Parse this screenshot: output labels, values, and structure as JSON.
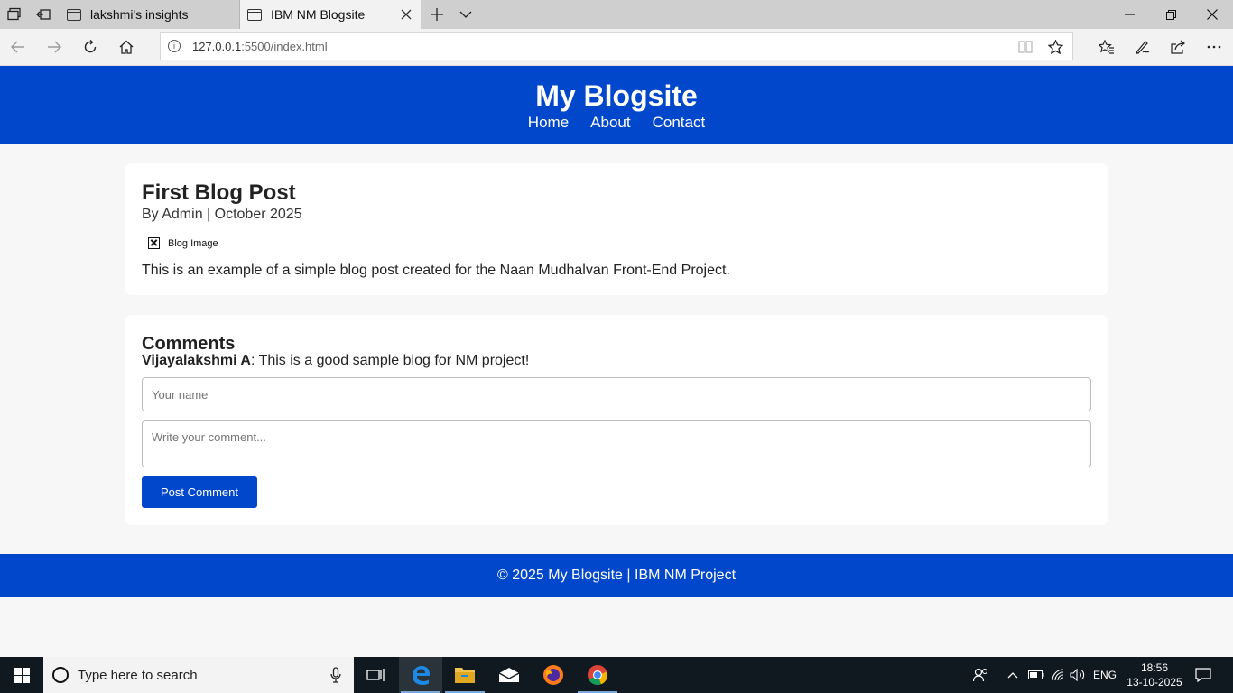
{
  "browser": {
    "tabs": [
      {
        "label": "lakshmi's insights"
      },
      {
        "label": "IBM NM Blogsite"
      }
    ],
    "url": {
      "host": "127.0.0.1",
      "path": ":5500/index.html"
    }
  },
  "site": {
    "title": "My Blogsite",
    "nav": [
      "Home",
      "About",
      "Contact"
    ],
    "post": {
      "title": "First Blog Post",
      "meta": "By Admin | October 2025",
      "image_alt": "Blog Image",
      "body": "This is an example of a simple blog post created for the Naan Mudhalvan Front-End Project."
    },
    "comments": {
      "title": "Comments",
      "items": [
        {
          "author": "Vijayalakshmi A",
          "text": ": This is a good sample blog for NM project!"
        }
      ],
      "name_placeholder": "Your name",
      "comment_placeholder": "Write your comment...",
      "submit_label": "Post Comment"
    },
    "footer": "© 2025 My Blogsite | IBM NM Project"
  },
  "taskbar": {
    "search_placeholder": "Type here to search",
    "language": "ENG",
    "time": "18:56",
    "date": "13-10-2025"
  },
  "colors": {
    "brand_blue": "#0047cc",
    "page_bg": "#f7f7f7"
  }
}
